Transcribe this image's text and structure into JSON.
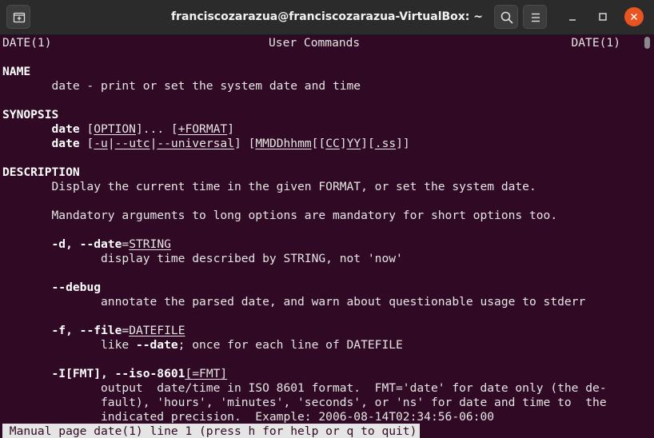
{
  "window": {
    "title": "franciscozarazua@franciscozarazua-VirtualBox: ~"
  },
  "man": {
    "header_left": "DATE(1)",
    "header_center": "User Commands",
    "header_right": "DATE(1)",
    "name_heading": "NAME",
    "name_desc": "       date - print or set the system date and time",
    "synopsis_heading": "SYNOPSIS",
    "syn1": {
      "indent": "       ",
      "cmd": "date",
      "sp1": " [",
      "opt": "OPTION",
      "rest1": "]... [",
      "fmt": "+FORMAT",
      "rest2": "]"
    },
    "syn2": {
      "indent": "       ",
      "cmd": "date",
      "sp1": " [",
      "u": "-u",
      "p1": "|",
      "utc": "--utc",
      "p2": "|",
      "universal": "--universal",
      "p3": "] [",
      "mmdd": "MMDDhhmm",
      "p4": "[[",
      "cc": "CC",
      "p5": "]",
      "yy": "YY",
      "p6": "][",
      "ss": ".ss",
      "p7": "]]"
    },
    "description_heading": "DESCRIPTION",
    "desc1": "       Display the current time in the given FORMAT, or set the system date.",
    "desc2": "       Mandatory arguments to long options are mandatory for short options too.",
    "opt_d": {
      "indent": "       ",
      "flag": "-d, --date",
      "eq": "=",
      "arg": "STRING",
      "desc": "              display time described by STRING, not 'now'"
    },
    "opt_debug": {
      "indent": "       ",
      "flag": "--debug",
      "desc": "              annotate the parsed date, and warn about questionable usage to stderr"
    },
    "opt_f": {
      "indent": "       ",
      "flag": "-f, --file",
      "eq": "=",
      "arg": "DATEFILE",
      "desc_pre": "              like ",
      "desc_bold": "--date",
      "desc_post": "; once for each line of DATEFILE"
    },
    "opt_i": {
      "indent": "       ",
      "flag": "-I[FMT], --iso-8601",
      "p1": "[",
      "arg": "=FMT",
      "p2": "]",
      "desc1": "              output  date/time in ISO 8601 format.  FMT='date' for date only (the de-",
      "desc2": "              fault), 'hours', 'minutes', 'seconds', or 'ns' for date and time to  the",
      "desc3": "              indicated precision.  Example: 2006-08-14T02:34:56-06:00"
    },
    "status": " Manual page date(1) line 1 (press h for help or q to quit)"
  },
  "icons": {
    "newtab": "new-tab-icon",
    "search": "search-icon",
    "menu": "hamburger-menu-icon",
    "minimize": "minimize-icon",
    "maximize": "maximize-icon",
    "close": "close-icon"
  },
  "colors": {
    "terminal_bg": "#300a24",
    "titlebar_bg": "#2b2b2b",
    "close_accent": "#e95420",
    "text": "#e5e5e5"
  }
}
